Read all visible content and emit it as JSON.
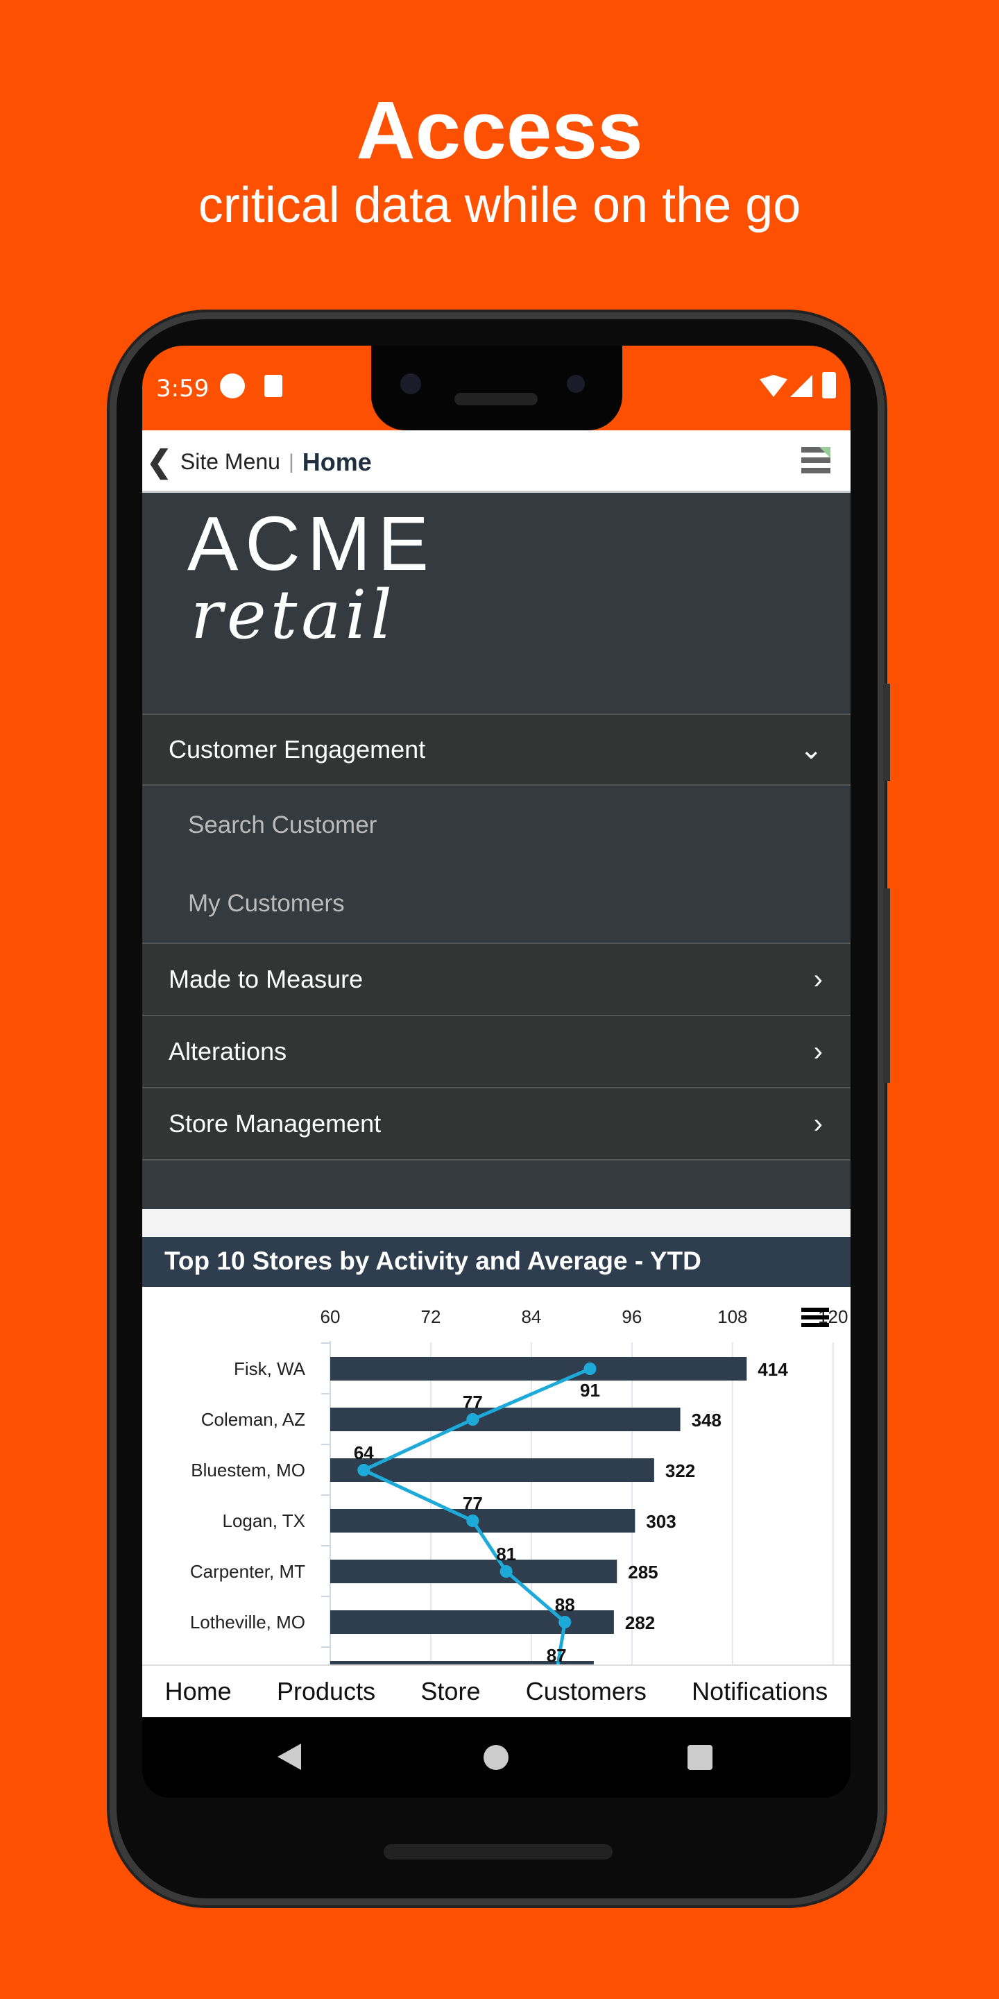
{
  "promo": {
    "title": "Access",
    "subtitle": "critical data while on the go"
  },
  "status_bar": {
    "time": "3:59"
  },
  "header": {
    "back_label": "Site Menu",
    "current": "Home"
  },
  "logo": {
    "line1": "ACME",
    "line2": "retail"
  },
  "menu": [
    {
      "label": "Customer Engagement",
      "expanded": true,
      "children": [
        "Search Customer",
        "My Customers"
      ]
    },
    {
      "label": "Made to Measure",
      "expanded": false
    },
    {
      "label": "Alterations",
      "expanded": false
    },
    {
      "label": "Store Management",
      "expanded": false
    }
  ],
  "chart_title": "Top 10 Stores by Activity and Average - YTD",
  "chart_data": {
    "type": "bar",
    "orientation": "horizontal",
    "title": "Top 10 Stores by Activity and Average - YTD",
    "categories": [
      "Fisk, WA",
      "Coleman, AZ",
      "Bluestem, MO",
      "Logan, TX",
      "Carpenter, MT",
      "Lotheville, MO",
      ""
    ],
    "series": [
      {
        "type": "bar",
        "values": [
          414,
          348,
          322,
          303,
          285,
          282,
          262
        ],
        "color": "#2e3e4e"
      },
      {
        "type": "line",
        "values": [
          91,
          77,
          64,
          77,
          81,
          88,
          87
        ],
        "color": "#1eaad9"
      }
    ],
    "top_axis": {
      "ticks": [
        60,
        72,
        84,
        96,
        108,
        120
      ],
      "range": [
        60,
        120
      ]
    },
    "grid": true
  },
  "tabs": [
    "Home",
    "Products",
    "Store",
    "Customers",
    "Notifications"
  ]
}
